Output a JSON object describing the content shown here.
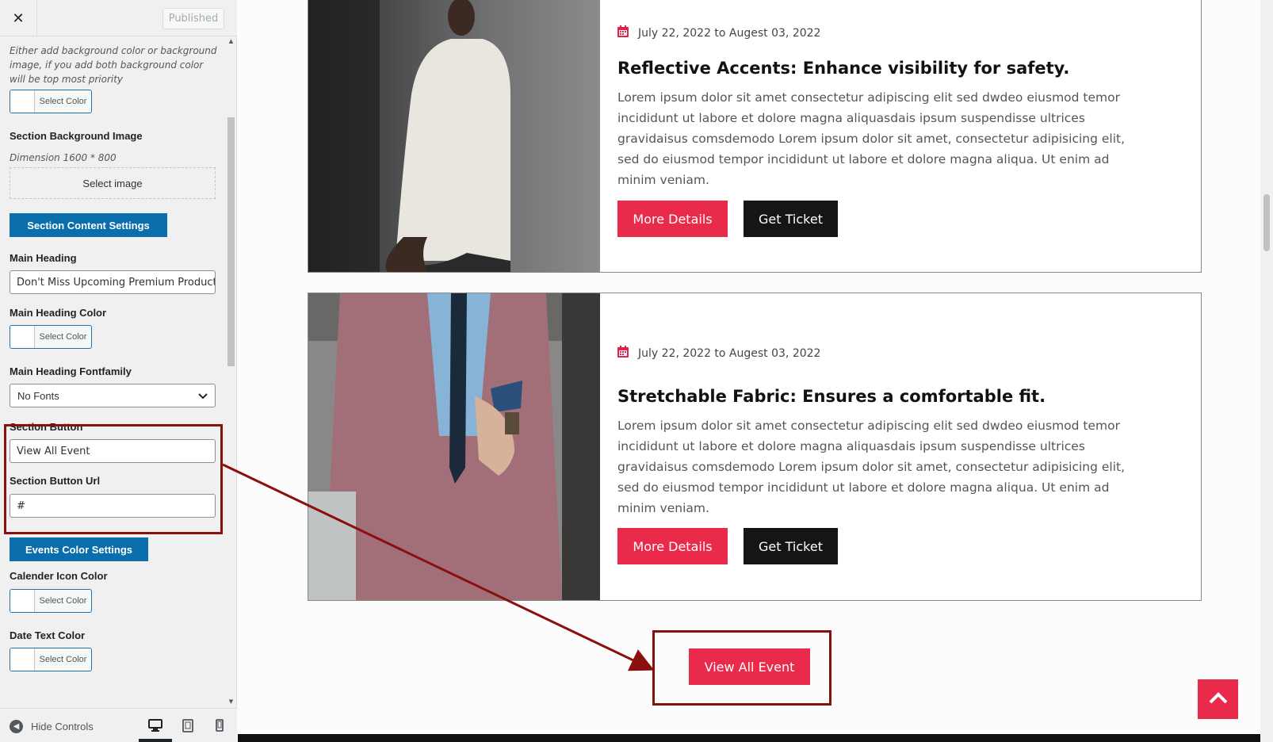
{
  "topbar": {
    "close_icon": "close-icon",
    "publish_label": "Published"
  },
  "sidebar": {
    "bg_color_desc": "Either add background color or background image, if you add both background color will be top most priority",
    "select_color_label": "Select Color",
    "bg_image_label": "Section Background Image",
    "bg_image_dimension": "Dimension 1600 * 800",
    "select_image_label": "Select image",
    "content_settings_label": "Section Content Settings",
    "main_heading_label": "Main Heading",
    "main_heading_value": "Don't Miss Upcoming Premium Product",
    "main_heading_color_label": "Main Heading Color",
    "main_heading_font_label": "Main Heading Fontfamily",
    "main_heading_font_value": "No Fonts",
    "section_button_label": "Section Button",
    "section_button_value": "View All Event",
    "section_button_url_label": "Section Button Url",
    "section_button_url_value": "#",
    "events_color_label": "Events Color Settings",
    "calendar_icon_color_label": "Calender Icon Color",
    "date_text_color_label": "Date Text Color",
    "hide_controls_label": "Hide Controls"
  },
  "events": [
    {
      "date": "July 22, 2022 to Augest 03, 2022",
      "title": "Reflective Accents: Enhance visibility for safety.",
      "desc": "Lorem ipsum dolor sit amet consectetur adipiscing elit sed dwdeo eiusmod temor incididunt ut labore et dolore magna aliquasdais ipsum suspendisse ultrices gravidaisus comsdemodo Lorem ipsum dolor sit amet, consectetur adipisicing elit, sed do eiusmod tempor incididunt ut labore et dolore magna aliqua. Ut enim ad minim veniam.",
      "details_label": "More Details",
      "ticket_label": "Get Ticket"
    },
    {
      "date": "July 22, 2022 to Augest 03, 2022",
      "title": "Stretchable Fabric: Ensures a comfortable fit.",
      "desc": "Lorem ipsum dolor sit amet consectetur adipiscing elit sed dwdeo eiusmod temor incididunt ut labore et dolore magna aliquasdais ipsum suspendisse ultrices gravidaisus comsdemodo Lorem ipsum dolor sit amet, consectetur adipisicing elit, sed do eiusmod tempor incididunt ut labore et dolore magna aliqua. Ut enim ad minim veniam.",
      "details_label": "More Details",
      "ticket_label": "Get Ticket"
    }
  ],
  "view_all_label": "View All Event",
  "colors": {
    "accent": "#ea2a4a",
    "dark": "#151515",
    "wp_blue": "#0a6ead",
    "highlight": "#8b0f0f"
  }
}
